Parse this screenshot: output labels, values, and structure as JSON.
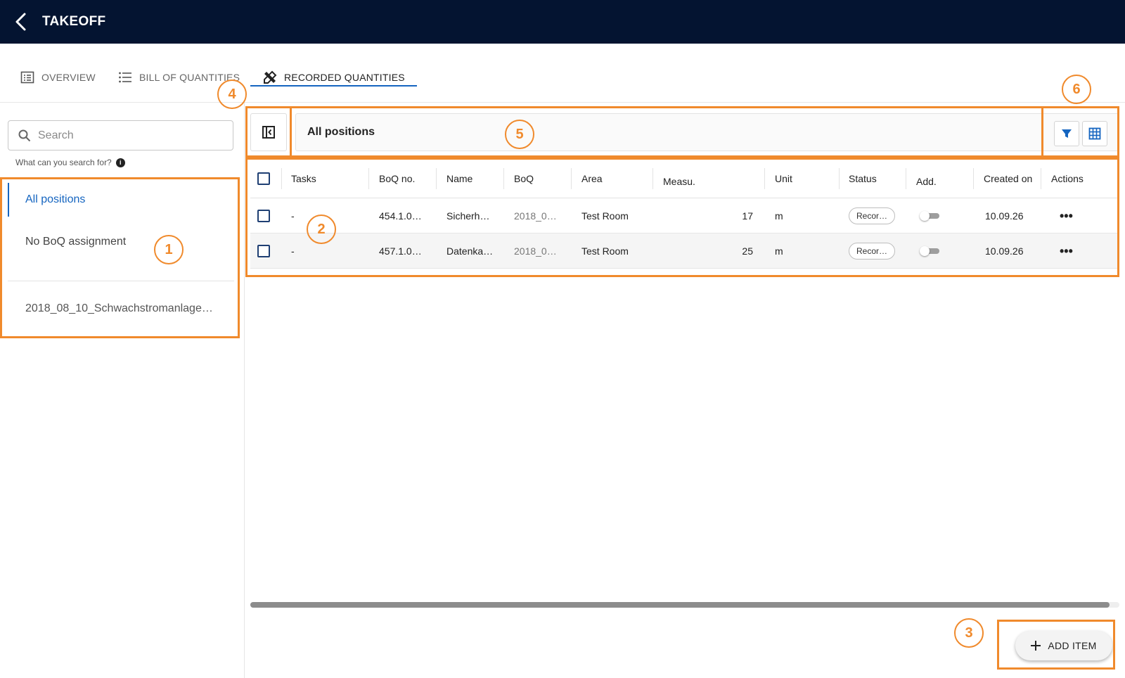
{
  "app": {
    "title": "TAKEOFF",
    "back_icon": "chevron-left-icon"
  },
  "tabs": [
    {
      "label": "OVERVIEW",
      "icon": "list-box-icon",
      "active": false
    },
    {
      "label": "BILL OF QUANTITIES",
      "icon": "bulleted-list-icon",
      "active": false
    },
    {
      "label": "RECORDED QUANTITIES",
      "icon": "ruler-pencil-icon",
      "active": true
    }
  ],
  "sidebar": {
    "search": {
      "placeholder": "Search",
      "value": ""
    },
    "search_hint": "What can you search for?",
    "items": [
      {
        "label": "All positions",
        "active": true
      },
      {
        "label": "No BoQ assignment",
        "active": false
      },
      {
        "label": "2018_08_10_Schwachstromanlage…",
        "active": false
      }
    ]
  },
  "header": {
    "title": "All positions"
  },
  "table": {
    "columns": [
      "Tasks",
      "BoQ no.",
      "Name",
      "BoQ",
      "Area",
      "Measu.",
      "Unit",
      "Status",
      "Add.",
      "Created on",
      "Actions"
    ],
    "rows": [
      {
        "tasks": "-",
        "boq_no": "454.1.0…",
        "name": "Sicherh…",
        "boq": "2018_0…",
        "area": "Test Room",
        "measure": "17",
        "unit": "m",
        "status": "Recor…",
        "add": false,
        "created": "10.09.26"
      },
      {
        "tasks": "-",
        "boq_no": "457.1.0…",
        "name": "Datenka…",
        "boq": "2018_0…",
        "area": "Test Room",
        "measure": "25",
        "unit": "m",
        "status": "Recor…",
        "add": false,
        "created": "10.09.26"
      }
    ]
  },
  "add_button": {
    "label": "ADD ITEM"
  },
  "annotations": [
    "1",
    "2",
    "3",
    "4",
    "5",
    "6"
  ],
  "colors": {
    "topbar": "#041431",
    "accent": "#1565c0",
    "annotation": "#f08a2c"
  }
}
